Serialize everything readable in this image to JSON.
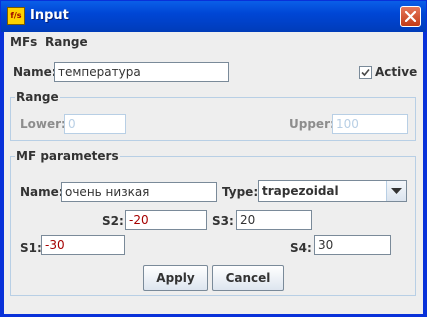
{
  "window": {
    "title": "Input",
    "app_icon_text": "f/s"
  },
  "menu": [
    {
      "label": "MFs"
    },
    {
      "label": "Range"
    }
  ],
  "name": {
    "label": "Name:",
    "value": "температура"
  },
  "active": {
    "label": "Active",
    "checked": true
  },
  "range": {
    "title": "Range",
    "lower_label": "Lower:",
    "lower_placeholder": "0",
    "upper_label": "Upper:",
    "upper_placeholder": "100"
  },
  "mf": {
    "title": "MF parameters",
    "name_label": "Name:",
    "name_value": "очень низкая",
    "type_label": "Type:",
    "type_value": "trapezoidal",
    "s1_label": "S1:",
    "s1_value": "-30",
    "s2_label": "S2:",
    "s2_value": "-20",
    "s3_label": "S3:",
    "s3_value": "20",
    "s4_label": "S4:",
    "s4_value": "30"
  },
  "buttons": {
    "apply": "Apply",
    "cancel": "Cancel"
  }
}
